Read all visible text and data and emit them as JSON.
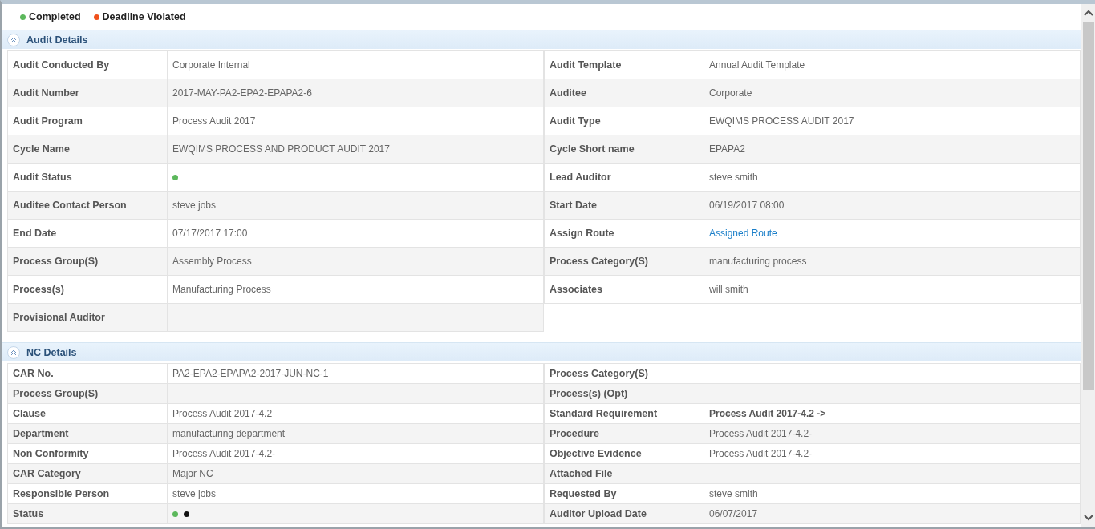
{
  "legend": [
    {
      "label": "Completed",
      "color": "#5cb85c"
    },
    {
      "label": "Deadline Violated",
      "color": "#f0511c"
    }
  ],
  "sections": [
    {
      "title": "Audit Details",
      "expanded": true,
      "kind": "tall",
      "rows": [
        [
          {
            "label": "Audit Conducted By",
            "kind": "text",
            "value": "Corporate Internal"
          },
          {
            "label": "Audit Template",
            "kind": "text",
            "value": "Annual Audit Template"
          }
        ],
        [
          {
            "label": "Audit Number",
            "kind": "text",
            "value": "2017-MAY-PA2-EPA2-EPAPA2-6"
          },
          {
            "label": "Auditee",
            "kind": "text",
            "value": "Corporate"
          }
        ],
        [
          {
            "label": "Audit Program",
            "kind": "text",
            "value": "Process Audit 2017"
          },
          {
            "label": "Audit Type",
            "kind": "text",
            "value": "EWQIMS PROCESS AUDIT 2017"
          }
        ],
        [
          {
            "label": "Cycle Name",
            "kind": "text",
            "value": "EWQIMS PROCESS AND PRODUCT AUDIT 2017"
          },
          {
            "label": "Cycle Short name",
            "kind": "text",
            "value": "EPAPA2"
          }
        ],
        [
          {
            "label": "Audit Status",
            "kind": "status",
            "dots": [
              {
                "color": "#5cb85c"
              }
            ]
          },
          {
            "label": "Lead Auditor",
            "kind": "text",
            "value": "steve smith"
          }
        ],
        [
          {
            "label": "Auditee Contact Person",
            "kind": "text",
            "value": "steve jobs"
          },
          {
            "label": "Start Date",
            "kind": "text",
            "value": "06/19/2017 08:00"
          }
        ],
        [
          {
            "label": "End Date",
            "kind": "text",
            "value": "07/17/2017 17:00"
          },
          {
            "label": "Assign Route",
            "kind": "link",
            "value": "Assigned Route"
          }
        ],
        [
          {
            "label": "Process Group(S)",
            "kind": "text",
            "value": "Assembly Process"
          },
          {
            "label": "Process Category(S)",
            "kind": "text",
            "value": "manufacturing process"
          }
        ],
        [
          {
            "label": "Process(s)",
            "kind": "text",
            "value": "Manufacturing Process"
          },
          {
            "label": "Associates",
            "kind": "text",
            "value": "will smith"
          }
        ],
        [
          {
            "label": "Provisional Auditor",
            "kind": "text"
          }
        ]
      ]
    },
    {
      "title": "NC Details",
      "expanded": true,
      "kind": "compact",
      "rows": [
        [
          {
            "label": "CAR No.",
            "kind": "text",
            "value": "PA2-EPA2-EPAPA2-2017-JUN-NC-1"
          },
          {
            "label": "Process Category(S)",
            "kind": "text"
          }
        ],
        [
          {
            "label": "Process Group(S)",
            "kind": "text"
          },
          {
            "label": "Process(s) (Opt)",
            "kind": "text"
          }
        ],
        [
          {
            "label": "Clause",
            "kind": "text",
            "value": "Process Audit 2017-4.2"
          },
          {
            "label": "Standard Requirement",
            "kind": "strong",
            "value": "Process Audit 2017-4.2 ->"
          }
        ],
        [
          {
            "label": "Department",
            "kind": "text",
            "value": "manufacturing department"
          },
          {
            "label": "Procedure",
            "kind": "text",
            "value": "Process Audit 2017-4.2-"
          }
        ],
        [
          {
            "label": "Non Conformity",
            "kind": "text",
            "value": "Process Audit 2017-4.2-"
          },
          {
            "label": "Objective Evidence",
            "kind": "text",
            "value": "Process Audit 2017-4.2-"
          }
        ],
        [
          {
            "label": "CAR Category",
            "kind": "text",
            "value": "Major NC"
          },
          {
            "label": "Attached File",
            "kind": "text"
          }
        ],
        [
          {
            "label": "Responsible Person",
            "kind": "text",
            "value": "steve jobs"
          },
          {
            "label": "Requested By",
            "kind": "text",
            "value": "steve smith"
          }
        ],
        [
          {
            "label": "Status",
            "kind": "status",
            "dots": [
              {
                "color": "#5cb85c"
              },
              {
                "color": "#111111"
              }
            ]
          },
          {
            "label": "Auditor Upload Date",
            "kind": "text",
            "value": "06/07/2017"
          }
        ]
      ]
    }
  ]
}
